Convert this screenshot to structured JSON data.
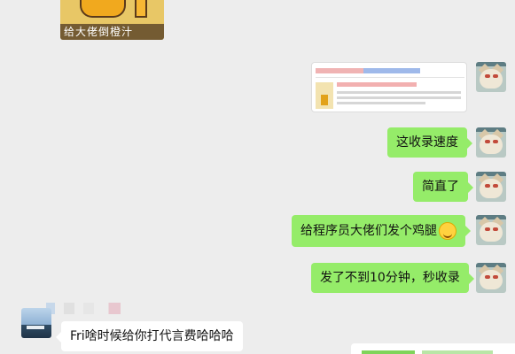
{
  "sticker": {
    "caption": "给大佬倒橙汁"
  },
  "messages_me": [
    {
      "text": "这收录速度"
    },
    {
      "text": "简直了"
    },
    {
      "text": "给程序员大佬们发个鸡腿"
    },
    {
      "text": "发了不到10分钟，秒收录"
    }
  ],
  "message_other": {
    "text": "Fri啥时候给你打代言费哈哈哈"
  },
  "colors": {
    "bubble_me": "#95ec69",
    "bubble_other": "#ffffff",
    "background": "#ededed"
  }
}
